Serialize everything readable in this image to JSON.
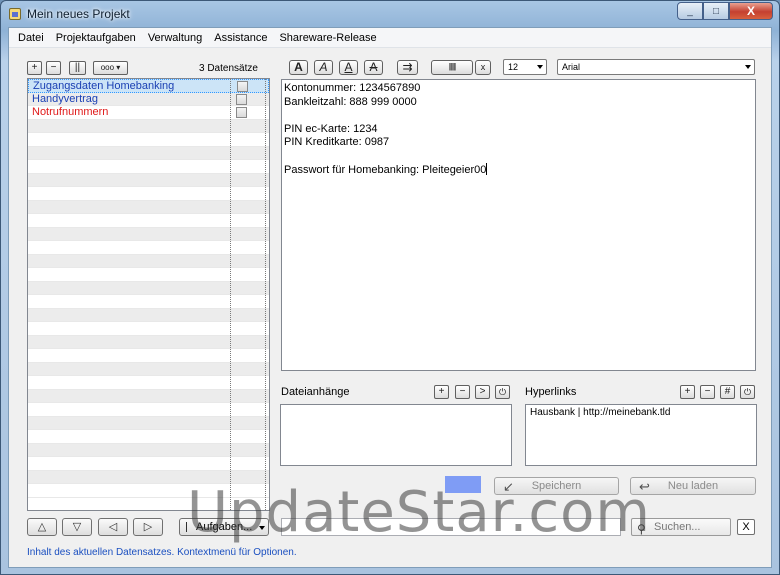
{
  "window": {
    "title": "Mein neues Projekt"
  },
  "caption": {
    "min": "_",
    "max": "□",
    "close": "X"
  },
  "menu": [
    "Datei",
    "Projektaufgaben",
    "Verwaltung",
    "Assistance",
    "Shareware-Release"
  ],
  "list_toolbar": {
    "add": "+",
    "remove": "−",
    "pause": "||",
    "more": "ooo ▾"
  },
  "record_count": "3 Datensätze",
  "records": [
    {
      "label": "Zugangsdaten Homebanking",
      "color": "#1a3fb3"
    },
    {
      "label": "Handyvertrag",
      "color": "#1a3fb3"
    },
    {
      "label": "Notrufnummern",
      "color": "#e01a1a"
    }
  ],
  "format_toolbar": {
    "bold": "A",
    "italic": "A",
    "underline": "A",
    "strike": "A",
    "indent": "⇉",
    "barcode": "||||||",
    "clear": "x",
    "font_size": "12",
    "font_name": "Arial"
  },
  "editor_lines": [
    "Kontonummer: 1234567890",
    "Bankleitzahl: 888 999 0000",
    "",
    "PIN ec-Karte: 1234",
    "PIN Kreditkarte: 0987",
    "",
    "Passwort für Homebanking: Pleitegeier00"
  ],
  "attachments": {
    "label": "Dateianhänge",
    "add": "+",
    "remove": "−",
    "open": ">",
    "power": "⏻"
  },
  "hyperlinks": {
    "label": "Hyperlinks",
    "add": "+",
    "remove": "−",
    "hash": "#",
    "power": "⏻",
    "items": [
      "Hausbank | http://meinebank.tld"
    ]
  },
  "accent_color": "#7f9cf5",
  "buttons": {
    "save": "Speichern",
    "reload": "Neu laden"
  },
  "nav": {
    "up": "△",
    "down": "▽",
    "left": "◁",
    "right": "▷"
  },
  "tasks_dropdown": "Aufgaben...",
  "search": {
    "placeholder": "Suchen...",
    "clear": "X"
  },
  "status_text": "Inhalt des aktuellen Datensatzes. Kontextmenü für Optionen.",
  "watermark": "UpdateStar.com"
}
